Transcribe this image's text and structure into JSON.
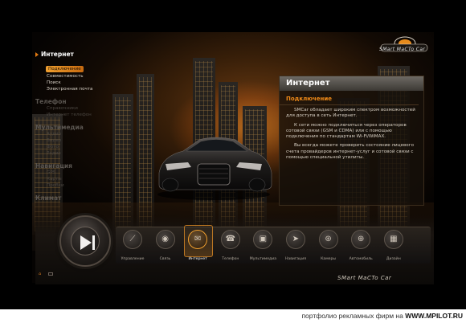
{
  "app": {
    "brand": "SMart MaCTo Car"
  },
  "menu": {
    "categories": [
      {
        "label": "Интернет",
        "active": true,
        "items": [
          "Подключение",
          "Совместимость",
          "Поиск",
          "Электронная почта"
        ],
        "selected": 0
      },
      {
        "label": "Телефон",
        "active": false,
        "items": [
          "Справочники",
          "Интернет телефон"
        ]
      },
      {
        "label": "Мультимедиа",
        "active": false,
        "items": [
          "Аудио",
          "Видео",
          "Фото",
          "Радио"
        ]
      },
      {
        "label": "Навигация",
        "active": false,
        "items": [
          "GPS",
          "Карты",
          "Пробки"
        ]
      },
      {
        "label": "Климат",
        "active": false,
        "items": []
      }
    ]
  },
  "panel": {
    "title": "Интернет",
    "subtitle": "Подключение",
    "paragraphs": [
      "SMCar обладает широким спектром возможностей для доступа в сеть Интернет.",
      "К сети можно подключиться через операторов сотовой связи (GSM и CDMA) или с помощью подключения по стандартам Wi-Fi/WiMAX.",
      "Вы всегда можете проверить состояние лицевого счета провайдеров интернет-услуг и сотовой связи с помощью специальной утилиты."
    ]
  },
  "dock": {
    "items": [
      {
        "label": "Управление",
        "icon": "steering-icon",
        "glyph": "⟋"
      },
      {
        "label": "Связь",
        "icon": "signal-icon",
        "glyph": "◉"
      },
      {
        "label": "Интернет",
        "icon": "envelope-icon",
        "glyph": "✉",
        "active": true
      },
      {
        "label": "Телефон",
        "icon": "phone-icon",
        "glyph": "☎"
      },
      {
        "label": "Мультимедиа",
        "icon": "film-icon",
        "glyph": "▣"
      },
      {
        "label": "Навигация",
        "icon": "navigation-icon",
        "glyph": "➤"
      },
      {
        "label": "Камеры",
        "icon": "camera-icon",
        "glyph": "⊛"
      },
      {
        "label": "Автомобиль",
        "icon": "car-icon",
        "glyph": "⊕"
      },
      {
        "label": "Дизайн",
        "icon": "design-icon",
        "glyph": "▦"
      }
    ]
  },
  "footer": {
    "prefix": "портфолио рекламных фирм на",
    "site": "WWW.MPILOT.RU"
  }
}
